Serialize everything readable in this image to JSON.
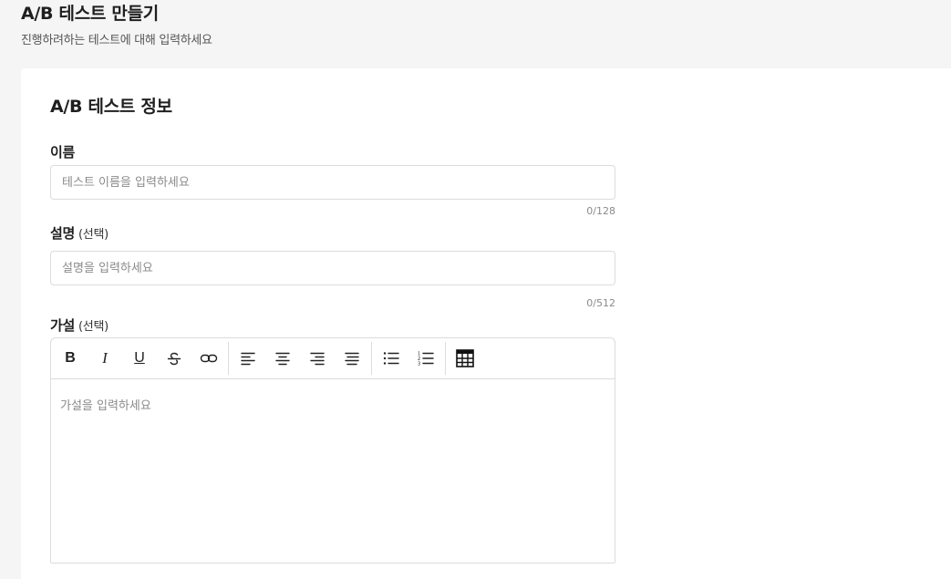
{
  "header": {
    "title": "A/B 테스트 만들기",
    "subtitle": "진행하려하는 테스트에 대해 입력하세요"
  },
  "section": {
    "title": "A/B 테스트 정보"
  },
  "fields": {
    "name": {
      "label": "이름",
      "placeholder": "테스트 이름을 입력하세요",
      "value": "",
      "counter": "0/128"
    },
    "description": {
      "label": "설명",
      "optional": "(선택)",
      "placeholder": "설명을 입력하세요",
      "value": "",
      "counter": "0/512"
    },
    "hypothesis": {
      "label": "가설",
      "optional": "(선택)",
      "placeholder": "가설을 입력하세요"
    }
  },
  "toolbar": {
    "icons": [
      "bold-icon",
      "italic-icon",
      "underline-icon",
      "strikethrough-icon",
      "link-icon",
      "align-left-icon",
      "align-center-icon",
      "align-right-icon",
      "align-justify-icon",
      "bullet-list-icon",
      "numbered-list-icon",
      "table-icon"
    ],
    "bold_glyph": "B",
    "italic_glyph": "I",
    "underline_glyph": "U"
  },
  "colors": {
    "background": "#f5f5f5",
    "card": "#ffffff",
    "border": "#dcdcdc",
    "placeholder": "#8a8a8a"
  }
}
